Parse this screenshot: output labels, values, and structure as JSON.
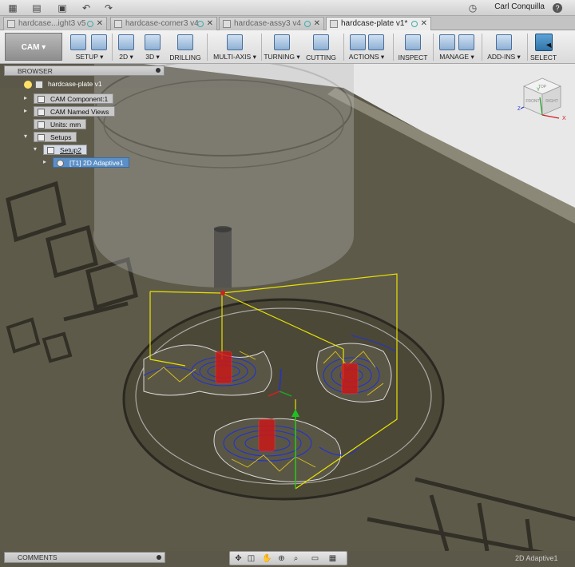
{
  "topbar": {
    "icons": [
      "grid-icon",
      "file-icon",
      "save-icon",
      "undo-icon",
      "redo-icon"
    ],
    "user_name": "Carl Conquilla",
    "help_label": "?"
  },
  "tabs": [
    {
      "label": "hardcase...ight3 v5",
      "active": false
    },
    {
      "label": "hardcase-corner3 v4",
      "active": false
    },
    {
      "label": "hardcase-assy3 v4",
      "active": false
    },
    {
      "label": "hardcase-plate v1*",
      "active": true
    }
  ],
  "workspace": {
    "label": "CAM ▾"
  },
  "toolbar": {
    "groups": [
      {
        "label": "SETUP ▾"
      },
      {
        "label": "2D ▾"
      },
      {
        "label": "3D ▾"
      },
      {
        "label": "DRILLING"
      },
      {
        "label": "MULTI-AXIS ▾"
      },
      {
        "label": "TURNING ▾"
      },
      {
        "label": "CUTTING"
      },
      {
        "label": "ACTIONS ▾"
      },
      {
        "label": "INSPECT"
      },
      {
        "label": "MANAGE ▾"
      },
      {
        "label": "ADD-INS ▾"
      },
      {
        "label": "SELECT"
      }
    ]
  },
  "browser": {
    "title": "BROWSER",
    "tree": [
      {
        "label": "hardcase-plate v1"
      },
      {
        "label": "CAM Component:1"
      },
      {
        "label": "CAM Named Views"
      },
      {
        "label": "Units: mm"
      },
      {
        "label": "Setups"
      },
      {
        "label": "Setup2"
      },
      {
        "label": "[T1] 2D Adaptive1"
      }
    ]
  },
  "viewcube": {
    "top": "TOP",
    "front": "FRONT",
    "right": "RIGHT",
    "axis_x": "X",
    "axis_y": "Y",
    "axis_z": "Z"
  },
  "model": {
    "text_upper": "blab",
    "text_lower": "UAE"
  },
  "comments": {
    "title": "COMMENTS"
  },
  "status_text": "2D Adaptive1",
  "colors": {
    "toolpath_blue": "#2233cc",
    "toolpath_yellow": "#d9c21a",
    "stock_yellow": "#e6e200",
    "drill_red": "#c81818",
    "model_gray": "#5c5849"
  }
}
